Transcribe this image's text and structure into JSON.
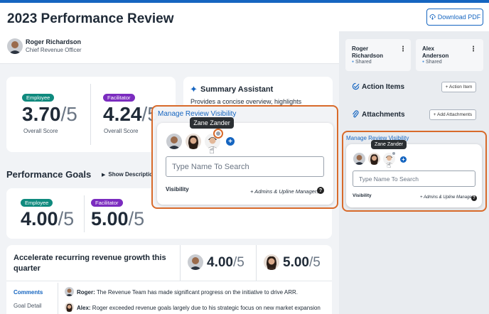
{
  "header": {
    "title": "2023 Performance Review",
    "download_label": "Download PDF"
  },
  "person": {
    "name": "Roger Richardson",
    "role": "Chief Revenue Officer"
  },
  "overall": {
    "employee_label": "Employee",
    "employee_score": "3.70",
    "facilitator_label": "Facilitator",
    "facilitator_score": "4.24",
    "denominator": "/5",
    "score_label": "Overall Score"
  },
  "summary": {
    "title": "Summary Assistant",
    "text": "Provides a concise overview, highlights"
  },
  "goals": {
    "title": "Performance Goals",
    "show_desc": "Show Descriptio",
    "employee_label": "Employee",
    "employee_score": "4.00",
    "facilitator_label": "Facilitator",
    "facilitator_score": "5.00",
    "denominator": "/5"
  },
  "goal_item": {
    "text": "Accelerate recurring revenue growth this quarter",
    "score_a": "4.00",
    "score_b": "5.00",
    "denominator": "/5",
    "comments_tab": "Comments",
    "goal_detail_tab": "Goal Detail",
    "comments": [
      {
        "author": "Roger:",
        "text": "The Revenue Team has made significant progress on the initiative to drive ARR."
      },
      {
        "author": "Alex:",
        "text": "Roger exceeded revenue goals largely due to his strategic focus on new market expansion"
      }
    ]
  },
  "right_panel": {
    "participants": [
      {
        "name_line1": "Roger",
        "name_line2": "Richardson",
        "status": "Shared"
      },
      {
        "name_line1": "Alex",
        "name_line2": "Anderson",
        "status": "Shared"
      }
    ],
    "action_items_title": "Action Items",
    "action_item_btn": "+ Action Item",
    "attachments_title": "Attachments",
    "attachments_btn": "+ Add Attachments"
  },
  "visibility_popup": {
    "title": "Manage Review Visibility",
    "tooltip": "Zane Zander",
    "search_placeholder": "Type Name To Search",
    "visibility_label": "Visibility",
    "visibility_value": "+ Admins & Upline Managers",
    "help": "?"
  },
  "colors": {
    "accent": "#1565c0",
    "employee": "#0f8a7e",
    "facilitator": "#7b2cbf",
    "highlight": "#d86a2a"
  }
}
